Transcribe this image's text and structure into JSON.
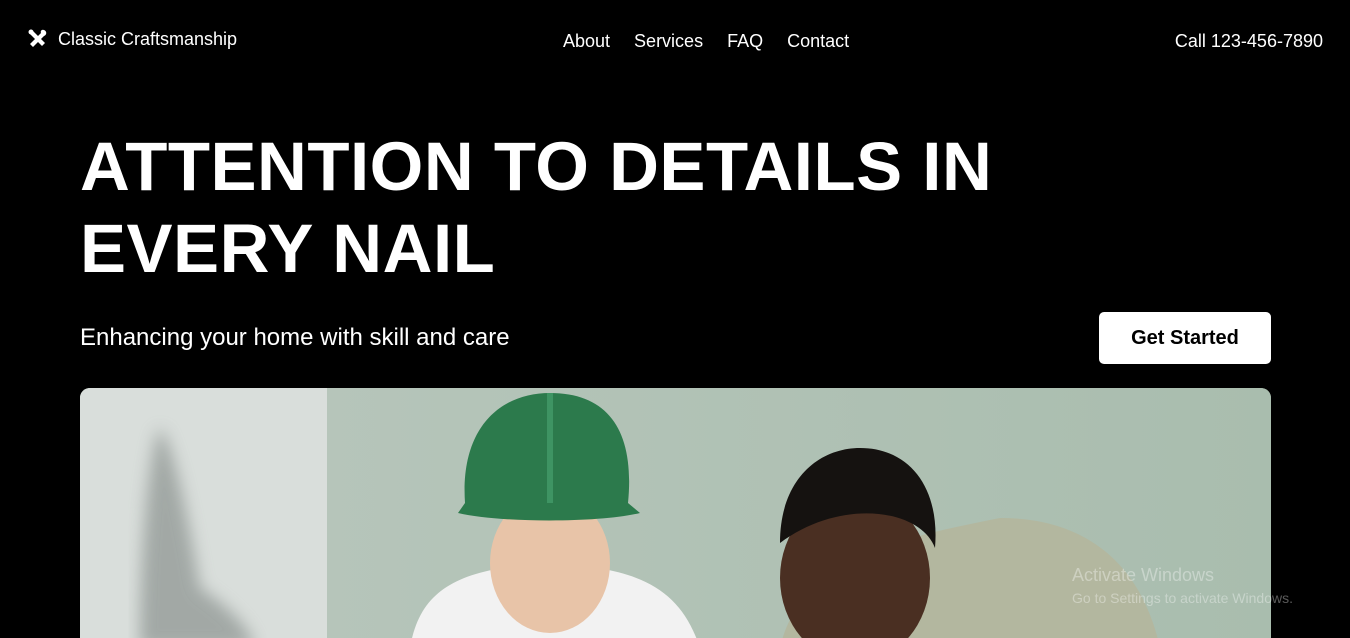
{
  "nav": {
    "brand_icon": "tools-icon",
    "brand_name": "Classic Craftsmanship",
    "links": [
      "About",
      "Services",
      "FAQ",
      "Contact"
    ],
    "call": "Call 123-456-7890"
  },
  "hero": {
    "title": "ATTENTION TO DETAILS IN EVERY NAIL",
    "subtitle": "Enhancing your home with skill and care",
    "cta": "Get Started",
    "image_desc": "two-workers-photo"
  },
  "watermark": {
    "title": "Activate Windows",
    "subtitle": "Go to Settings to activate Windows."
  },
  "colors": {
    "background": "#000000",
    "text": "#ffffff",
    "cta_bg": "#ffffff",
    "cta_text": "#000000",
    "wall": "#a7b8aa",
    "helmet": "#2c7a4c"
  }
}
